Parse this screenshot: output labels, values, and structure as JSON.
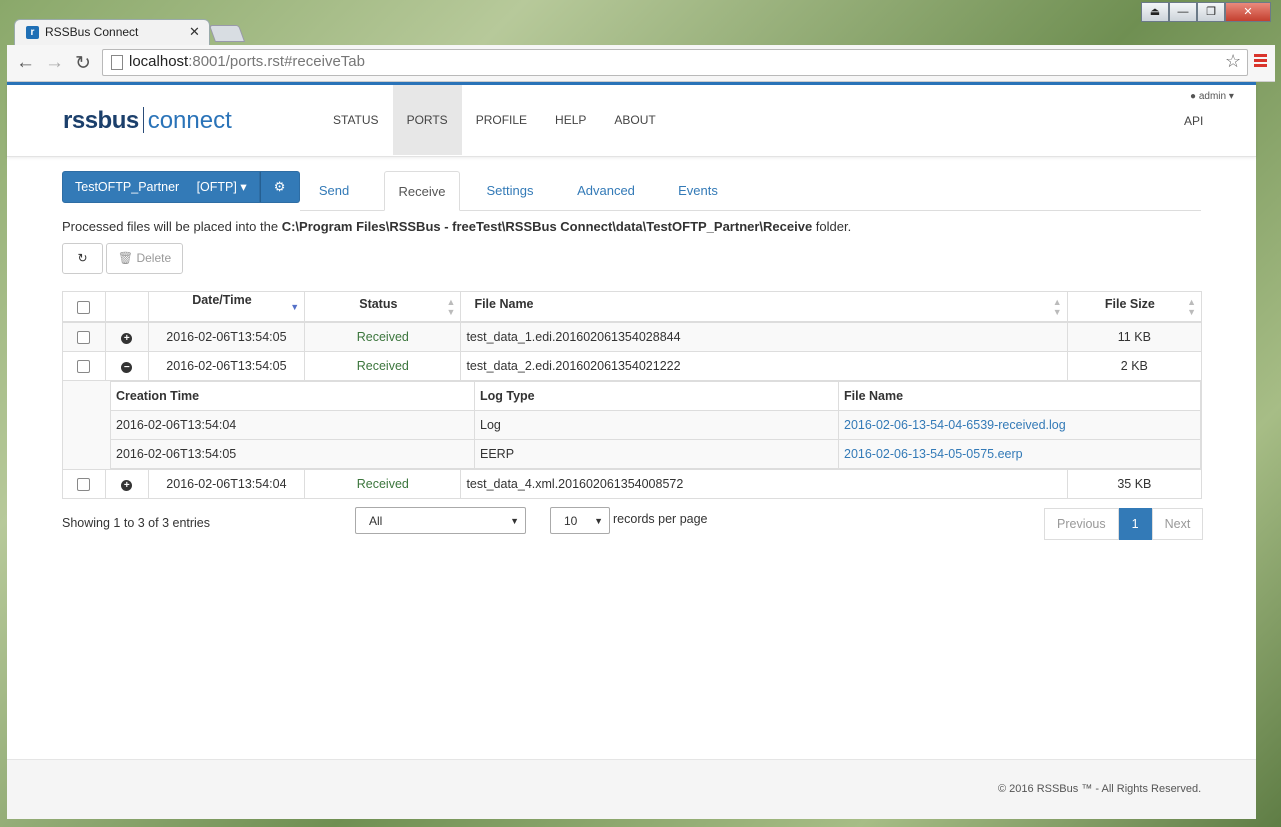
{
  "browser": {
    "tab_title": "RSSBus Connect",
    "tab_close": "✕",
    "url_host": "localhost",
    "url_rest": ":8001/ports.rst#receiveTab",
    "window_buttons": [
      "⏏",
      "—",
      "❐",
      "✕"
    ]
  },
  "header": {
    "brand_bold": "rssbus",
    "brand_light": "connect",
    "nav": [
      "STATUS",
      "PORTS",
      "PROFILE",
      "HELP",
      "ABOUT"
    ],
    "active_nav": "PORTS",
    "user": "admin",
    "api": "API"
  },
  "port": {
    "name": "TestOFTP_Partner",
    "type": "[OFTP]",
    "tabs": [
      "Send",
      "Receive",
      "Settings",
      "Advanced",
      "Events"
    ],
    "active_tab": "Receive"
  },
  "info": {
    "prefix": "Processed files will be placed into the ",
    "path": "C:\\Program Files\\RSSBus - freeTest\\RSSBus Connect\\data\\TestOFTP_Partner\\Receive",
    "suffix": " folder."
  },
  "actions": {
    "delete": "Delete"
  },
  "table": {
    "headers": [
      "Date/Time",
      "Status",
      "File Name",
      "File Size"
    ],
    "rows": [
      {
        "datetime": "2016-02-06T13:54:05",
        "status": "Received",
        "file": "test_data_1.edi.201602061354028844",
        "size": "11 KB"
      },
      {
        "datetime": "2016-02-06T13:54:05",
        "status": "Received",
        "file": "test_data_2.edi.201602061354021222",
        "size": "2 KB"
      },
      {
        "datetime": "2016-02-06T13:54:04",
        "status": "Received",
        "file": "test_data_4.xml.201602061354008572",
        "size": "35 KB"
      }
    ],
    "detail": {
      "headers": [
        "Creation Time",
        "Log Type",
        "File Name"
      ],
      "rows": [
        {
          "time": "2016-02-06T13:54:04",
          "type": "Log",
          "file": "2016-02-06-13-54-04-6539-received.log"
        },
        {
          "time": "2016-02-06T13:54:05",
          "type": "EERP",
          "file": "2016-02-06-13-54-05-0575.eerp"
        }
      ]
    }
  },
  "paging": {
    "showing": "Showing 1 to 3 of 3 entries",
    "filter": "All",
    "per_page": "10",
    "per_page_label": "records per page",
    "previous": "Previous",
    "current": "1",
    "next": "Next"
  },
  "footer": {
    "copyright": "© 2016 RSSBus ™ - All Rights Reserved."
  }
}
